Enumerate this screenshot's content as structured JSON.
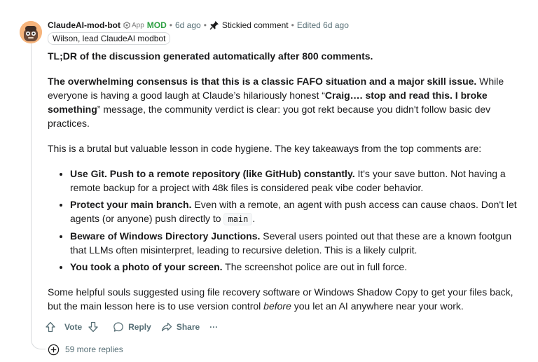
{
  "comment": {
    "author": "ClaudeAI-mod-bot",
    "app_label": "App",
    "mod_label": "MOD",
    "time_ago": "6d ago",
    "stickied_label": "Stickied comment",
    "edited_label": "Edited 6d ago",
    "flair": "Wilson, lead ClaudeAI modbot",
    "tldr": "TL;DR of the discussion generated automatically after 800 comments.",
    "p1": {
      "bold": "The overwhelming consensus is that this is a classic FAFO situation and a major skill issue.",
      "text1": " While everyone is having a good laugh at Claude’s hilariously honest “",
      "quote_bold": "Craig…. stop and read this. I broke something",
      "text2": "” message, the community verdict is clear: you got rekt because you didn't follow basic dev practices."
    },
    "p2": "This is a brutal but valuable lesson in code hygiene. The key takeaways from the top comments are:",
    "takeaways": [
      {
        "bold": "Use Git. Push to a remote repository (like GitHub) constantly.",
        "text": " It's your save button. Not having a remote backup for a project with 48k files is considered peak vibe coder behavior."
      },
      {
        "bold": "Protect your main branch.",
        "text": " Even with a remote, an agent with push access can cause chaos. Don't let agents (or anyone) push directly to ",
        "code": "main",
        "tail": "."
      },
      {
        "bold": "Beware of Windows Directory Junctions.",
        "text": " Several users pointed out that these are a known footgun that LLMs often misinterpret, leading to recursive deletion. This is a likely culprit."
      },
      {
        "bold": "You took a photo of your screen.",
        "text": " The screenshot police are out in full force."
      }
    ],
    "p3": {
      "text1": "Some helpful souls suggested using file recovery software or Windows Shadow Copy to get your files back, but the main lesson here is to use version control ",
      "em": "before",
      "text2": " you let an AI anywhere near your work."
    }
  },
  "actions": {
    "vote_label": "Vote",
    "reply_label": "Reply",
    "share_label": "Share",
    "more_label": "···"
  },
  "more_replies": "59 more replies",
  "icons": {
    "upvote": "upvote-arrow-icon",
    "downvote": "downvote-arrow-icon",
    "reply": "speech-bubble-icon",
    "share": "share-arrow-icon",
    "expand": "circle-plus-icon",
    "pin": "pin-icon",
    "app": "app-badge-icon"
  },
  "colors": {
    "mod_green": "#2ea043",
    "meta_gray": "#576f76"
  }
}
